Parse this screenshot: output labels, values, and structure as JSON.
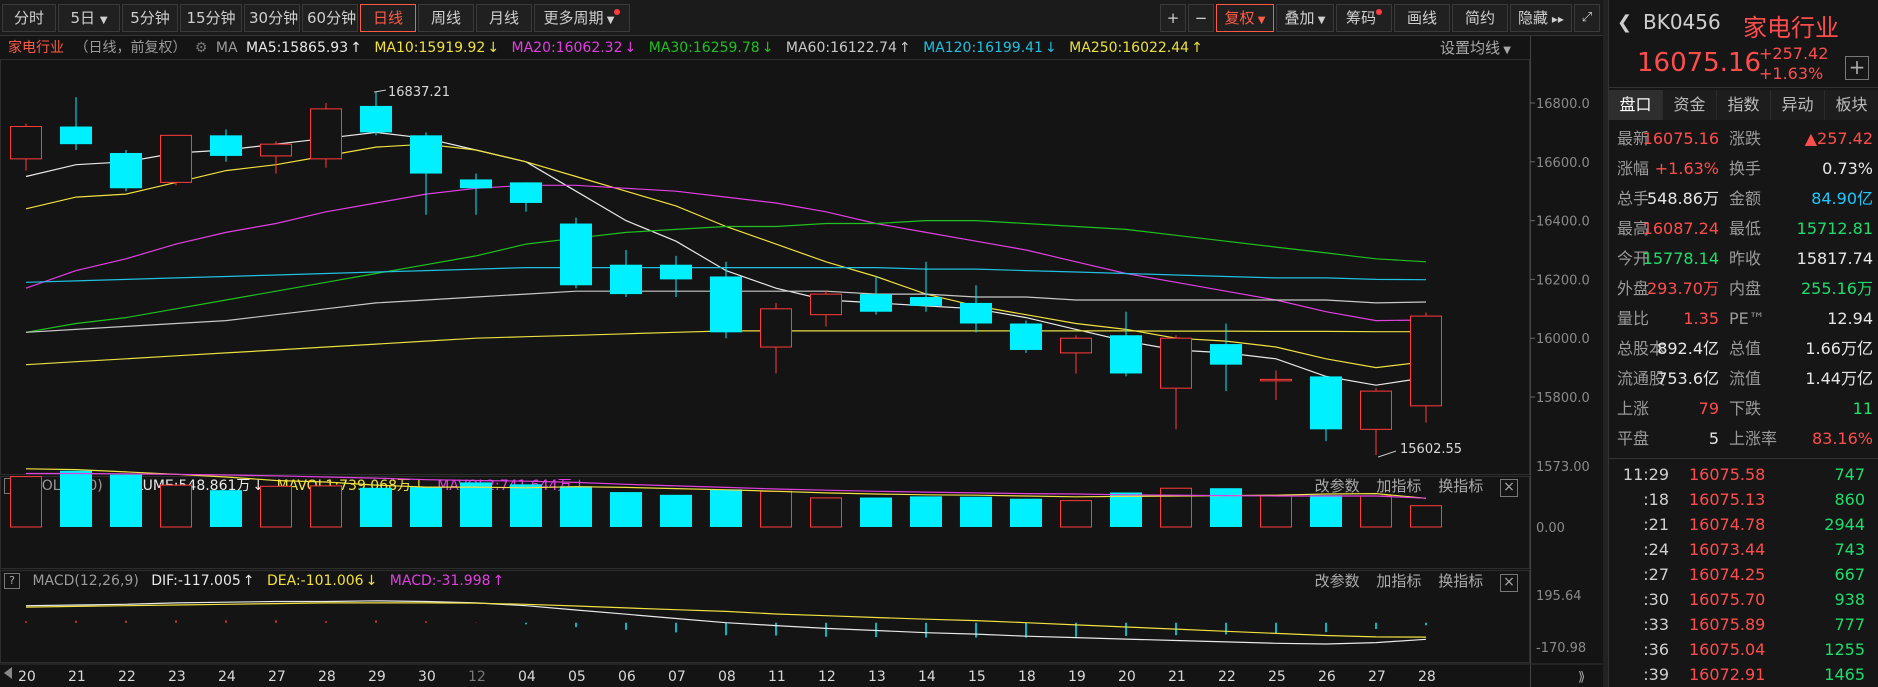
{
  "toolbar": {
    "periods": [
      "分时",
      "5日",
      "5分钟",
      "15分钟",
      "30分钟",
      "60分钟",
      "日线",
      "周线",
      "月线",
      "更多周期"
    ],
    "active_period": "日线",
    "plus": "+",
    "minus": "−",
    "fuquan": "复权",
    "diejia": "叠加",
    "chouma": "筹码",
    "huaxian": "画线",
    "jianyue": "简约",
    "hide": "隐藏",
    "expand_icon": "fullscreen-icon"
  },
  "main_legend": {
    "name": "家电行业",
    "mode": "（日线，前复权）",
    "ma_label": "MA",
    "ma5": "MA5:15865.93",
    "ma10": "MA10:15919.92",
    "ma20": "MA20:16062.32",
    "ma30": "MA30:16259.78",
    "ma60": "MA60:16122.74",
    "ma120": "MA120:16199.41",
    "ma250": "MA250:16022.44",
    "settings": "设置均线"
  },
  "vol_legend": {
    "label": "VOL(5,10)",
    "volume": "VOLUME:548.861万",
    "mavol1": "MAVOL1:739.068万",
    "mavol2": "MAVOL2:741.644万"
  },
  "macd_legend": {
    "label": "MACD(12,26,9)",
    "dif": "DIF:-117.005",
    "dea": "DEA:-101.006",
    "macd": "MACD:-31.998"
  },
  "panel_links": {
    "params": "改参数",
    "add": "加指标",
    "swap": "换指标",
    "close": "×",
    "help": "?"
  },
  "annotations": {
    "high": "16837.21",
    "low": "15602.55"
  },
  "colors": {
    "up": "#ff3b3b",
    "down": "#00f0ff",
    "ma5": "#e8e8e8",
    "ma10": "#f0e040",
    "ma20": "#e040e0",
    "ma30": "#20c020",
    "ma60": "#c8c8c8",
    "ma120": "#20c0e0",
    "ma250": "#e8e040"
  },
  "chart_data": {
    "type": "candlestick",
    "price_axis": {
      "min": 15600,
      "max": 16800,
      "ticks": [
        "16800.0",
        "16600.0",
        "16400.0",
        "16200.0",
        "16000.0",
        "15800.0"
      ]
    },
    "x_labels": [
      "20",
      "21",
      "22",
      "23",
      "24",
      "27",
      "28",
      "29",
      "30",
      "12",
      "04",
      "05",
      "06",
      "07",
      "08",
      "11",
      "12",
      "13",
      "14",
      "15",
      "18",
      "19",
      "20",
      "21",
      "22",
      "25",
      "26",
      "27",
      "28"
    ],
    "candles": [
      {
        "o": 16610,
        "c": 16720,
        "h": 16730,
        "l": 16570
      },
      {
        "o": 16720,
        "c": 16660,
        "h": 16820,
        "l": 16640
      },
      {
        "o": 16630,
        "c": 16510,
        "h": 16640,
        "l": 16500
      },
      {
        "o": 16530,
        "c": 16690,
        "h": 16690,
        "l": 16520
      },
      {
        "o": 16690,
        "c": 16620,
        "h": 16710,
        "l": 16600
      },
      {
        "o": 16620,
        "c": 16660,
        "h": 16670,
        "l": 16560
      },
      {
        "o": 16610,
        "c": 16780,
        "h": 16800,
        "l": 16580
      },
      {
        "o": 16790,
        "c": 16700,
        "h": 16837.21,
        "l": 16690
      },
      {
        "o": 16690,
        "c": 16560,
        "h": 16700,
        "l": 16420
      },
      {
        "o": 16540,
        "c": 16510,
        "h": 16560,
        "l": 16420
      },
      {
        "o": 16530,
        "c": 16460,
        "h": 16530,
        "l": 16430
      },
      {
        "o": 16390,
        "c": 16180,
        "h": 16410,
        "l": 16170
      },
      {
        "o": 16250,
        "c": 16150,
        "h": 16300,
        "l": 16140
      },
      {
        "o": 16250,
        "c": 16200,
        "h": 16280,
        "l": 16140
      },
      {
        "o": 16210,
        "c": 16020,
        "h": 16260,
        "l": 16000
      },
      {
        "o": 15970,
        "c": 16100,
        "h": 16120,
        "l": 15880
      },
      {
        "o": 16080,
        "c": 16150,
        "h": 16160,
        "l": 16040
      },
      {
        "o": 16150,
        "c": 16090,
        "h": 16210,
        "l": 16080
      },
      {
        "o": 16140,
        "c": 16110,
        "h": 16260,
        "l": 16090
      },
      {
        "o": 16120,
        "c": 16050,
        "h": 16180,
        "l": 16020
      },
      {
        "o": 16050,
        "c": 15960,
        "h": 16060,
        "l": 15950
      },
      {
        "o": 15950,
        "c": 16000,
        "h": 16010,
        "l": 15880
      },
      {
        "o": 16010,
        "c": 15880,
        "h": 16090,
        "l": 15870
      },
      {
        "o": 15830,
        "c": 16000,
        "h": 16010,
        "l": 15690
      },
      {
        "o": 15980,
        "c": 15910,
        "h": 16050,
        "l": 15820
      },
      {
        "o": 15860,
        "c": 15860,
        "h": 15890,
        "l": 15790
      },
      {
        "o": 15870,
        "c": 15690,
        "h": 15870,
        "l": 15650
      },
      {
        "o": 15690,
        "c": 15820,
        "h": 15830,
        "l": 15602.55
      },
      {
        "o": 15770,
        "c": 16075.16,
        "h": 16087.24,
        "l": 15712.81
      }
    ],
    "ma_series": [
      {
        "name": "MA5",
        "values": [
          16550,
          16590,
          16600,
          16630,
          16640,
          16660,
          16680,
          16700,
          16680,
          16640,
          16600,
          16500,
          16400,
          16330,
          16230,
          16170,
          16130,
          16120,
          16110,
          16100,
          16070,
          16030,
          15990,
          15960,
          15950,
          15930,
          15870,
          15840,
          15866
        ]
      },
      {
        "name": "MA10",
        "values": [
          16440,
          16480,
          16490,
          16530,
          16570,
          16590,
          16620,
          16650,
          16660,
          16640,
          16600,
          16550,
          16500,
          16450,
          16380,
          16320,
          16260,
          16210,
          16150,
          16110,
          16080,
          16050,
          16030,
          16000,
          15990,
          15970,
          15930,
          15900,
          15920
        ]
      },
      {
        "name": "MA20",
        "values": [
          16170,
          16230,
          16270,
          16320,
          16360,
          16390,
          16430,
          16460,
          16490,
          16510,
          16520,
          16520,
          16510,
          16500,
          16480,
          16460,
          16430,
          16390,
          16360,
          16330,
          16300,
          16260,
          16220,
          16190,
          16160,
          16130,
          16090,
          16060,
          16062
        ]
      },
      {
        "name": "MA30",
        "values": [
          16020,
          16050,
          16070,
          16100,
          16130,
          16160,
          16190,
          16220,
          16250,
          16280,
          16320,
          16340,
          16360,
          16370,
          16380,
          16380,
          16390,
          16390,
          16400,
          16400,
          16390,
          16380,
          16370,
          16350,
          16330,
          16310,
          16290,
          16270,
          16260
        ]
      },
      {
        "name": "MA60",
        "values": [
          16020,
          16030,
          16040,
          16050,
          16060,
          16080,
          16100,
          16120,
          16130,
          16140,
          16150,
          16160,
          16160,
          16160,
          16160,
          16160,
          16160,
          16150,
          16150,
          16140,
          16140,
          16130,
          16130,
          16130,
          16130,
          16130,
          16130,
          16120,
          16123
        ]
      },
      {
        "name": "MA120",
        "values": [
          16190,
          16195,
          16200,
          16205,
          16210,
          16215,
          16220,
          16225,
          16230,
          16235,
          16240,
          16240,
          16240,
          16240,
          16240,
          16240,
          16240,
          16240,
          16235,
          16235,
          16230,
          16225,
          16220,
          16215,
          16210,
          16205,
          16205,
          16200,
          16199
        ]
      },
      {
        "name": "MA250",
        "values": [
          15910,
          15920,
          15930,
          15940,
          15950,
          15960,
          15970,
          15980,
          15990,
          16000,
          16005,
          16010,
          16015,
          16020,
          16025,
          16025,
          16025,
          16025,
          16025,
          16025,
          16025,
          16025,
          16025,
          16024,
          16024,
          16023,
          16023,
          16022,
          16022
        ]
      }
    ],
    "volume_axis": {
      "max": 1573.0,
      "ticks": [
        "1573.00",
        "0.00"
      ]
    },
    "volume": [
      1300,
      1450,
      1350,
      1080,
      950,
      1050,
      1060,
      1010,
      1030,
      1150,
      1100,
      1050,
      900,
      830,
      970,
      920,
      750,
      760,
      790,
      780,
      730,
      680,
      890,
      1000,
      1000,
      800,
      820,
      800,
      549
    ],
    "mavol1": [
      1500,
      1480,
      1420,
      1360,
      1290,
      1200,
      1160,
      1080,
      1030,
      1030,
      1010,
      1040,
      1020,
      990,
      960,
      920,
      880,
      850,
      830,
      820,
      800,
      780,
      790,
      800,
      810,
      820,
      850,
      860,
      739
    ],
    "mavol2": [
      1380,
      1380,
      1370,
      1360,
      1340,
      1320,
      1290,
      1260,
      1220,
      1200,
      1180,
      1150,
      1100,
      1060,
      1020,
      980,
      950,
      920,
      900,
      880,
      860,
      850,
      830,
      820,
      810,
      800,
      800,
      800,
      742
    ],
    "macd_axis": {
      "max": 195.64,
      "min": -170.98,
      "ticks": [
        "195.64",
        "-170.98"
      ]
    },
    "dif": [
      120,
      125,
      130,
      140,
      145,
      150,
      150,
      155,
      150,
      140,
      120,
      90,
      60,
      30,
      0,
      -20,
      -40,
      -55,
      -70,
      -80,
      -95,
      -105,
      -115,
      -125,
      -135,
      -145,
      -150,
      -140,
      -117
    ],
    "dea": [
      110,
      115,
      120,
      125,
      130,
      135,
      140,
      140,
      140,
      138,
      130,
      118,
      105,
      92,
      80,
      62,
      50,
      37,
      25,
      15,
      0,
      -15,
      -30,
      -45,
      -60,
      -75,
      -90,
      -100,
      -101
    ],
    "macd": [
      20,
      25,
      25,
      30,
      30,
      30,
      20,
      30,
      20,
      4,
      -20,
      -56,
      -90,
      -124,
      -160,
      -164,
      -180,
      -184,
      -190,
      -190,
      -190,
      -180,
      -170,
      -160,
      -150,
      -140,
      -120,
      -80,
      -32
    ]
  },
  "right_panel": {
    "code": "BK0456",
    "name": "家电行业",
    "price": "16075.16",
    "change": "+257.42",
    "change_pct": "+1.63%",
    "add_icon": "plus-icon",
    "tabs": [
      "盘口",
      "资金",
      "指数",
      "异动",
      "板块"
    ],
    "active_tab": "盘口",
    "stats": [
      {
        "l1": "最新",
        "v1": "16075.16",
        "c1": "red",
        "l2": "涨跌",
        "v2": "▲257.42",
        "c2": "red"
      },
      {
        "l1": "涨幅",
        "v1": "+1.63%",
        "c1": "red",
        "l2": "换手",
        "v2": "0.73%",
        "c2": "white"
      },
      {
        "l1": "总手",
        "v1": "548.86万",
        "c1": "white",
        "l2": "金额",
        "v2": "84.90亿",
        "c2": "cyan"
      },
      {
        "l1": "最高",
        "v1": "16087.24",
        "c1": "red",
        "l2": "最低",
        "v2": "15712.81",
        "c2": "green"
      },
      {
        "l1": "今开",
        "v1": "15778.14",
        "c1": "green",
        "l2": "昨收",
        "v2": "15817.74",
        "c2": "white"
      },
      {
        "l1": "外盘",
        "v1": "293.70万",
        "c1": "red",
        "l2": "内盘",
        "v2": "255.16万",
        "c2": "green"
      },
      {
        "l1": "量比",
        "v1": "1.35",
        "c1": "red",
        "l2": "PE™",
        "v2": "12.94",
        "c2": "white"
      },
      {
        "l1": "总股本",
        "v1": "892.4亿",
        "c1": "white",
        "l2": "总值",
        "v2": "1.66万亿",
        "c2": "white"
      },
      {
        "l1": "流通股",
        "v1": "753.6亿",
        "c1": "white",
        "l2": "流值",
        "v2": "1.44万亿",
        "c2": "white"
      },
      {
        "l1": "上涨",
        "v1": "79",
        "c1": "red",
        "l2": "下跌",
        "v2": "11",
        "c2": "green"
      },
      {
        "l1": "平盘",
        "v1": "5",
        "c1": "white",
        "l2": "上涨率",
        "v2": "83.16%",
        "c2": "red"
      }
    ],
    "ticks": [
      {
        "t": "11:29",
        "p": "16075.58",
        "v": "747"
      },
      {
        "t": ":18",
        "p": "16075.13",
        "v": "860"
      },
      {
        "t": ":21",
        "p": "16074.78",
        "v": "2944"
      },
      {
        "t": ":24",
        "p": "16073.44",
        "v": "743"
      },
      {
        "t": ":27",
        "p": "16074.25",
        "v": "667"
      },
      {
        "t": ":30",
        "p": "16075.70",
        "v": "938"
      },
      {
        "t": ":33",
        "p": "16075.89",
        "v": "777"
      },
      {
        "t": ":36",
        "p": "16075.04",
        "v": "1255"
      },
      {
        "t": ":39",
        "p": "16072.91",
        "v": "1465"
      }
    ]
  }
}
